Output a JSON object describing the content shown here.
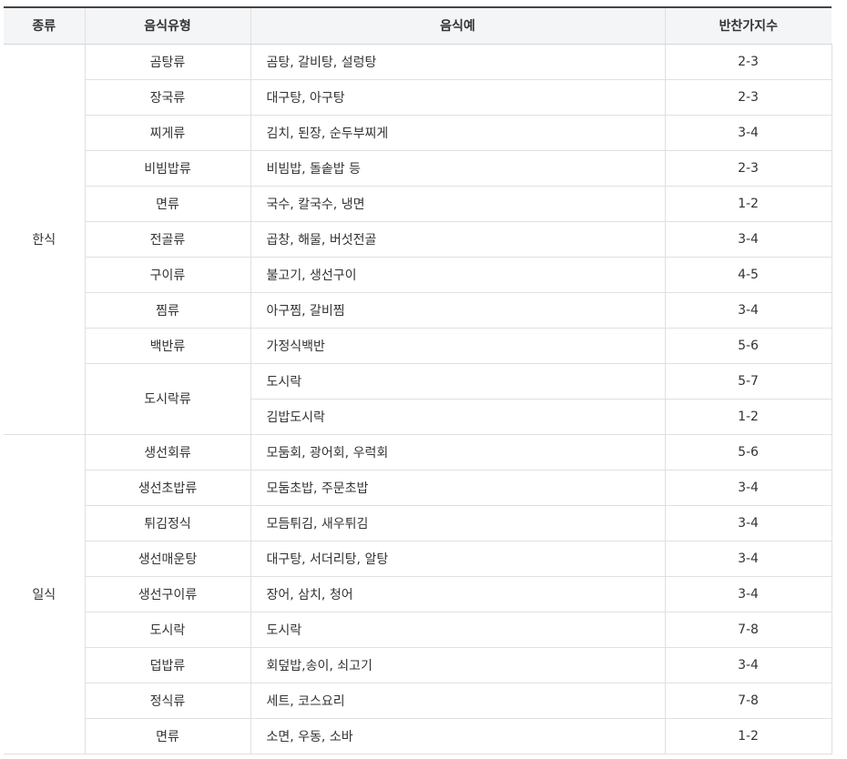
{
  "headers": [
    "종류",
    "음식유형",
    "음식예",
    "반찬가지수"
  ],
  "groups": [
    {
      "category": "한식",
      "types": [
        {
          "type": "곰탕류",
          "rows": [
            {
              "example": "곰탕, 갈비탕, 설렁탕",
              "count": "2-3"
            }
          ]
        },
        {
          "type": "장국류",
          "rows": [
            {
              "example": "대구탕, 아구탕",
              "count": "2-3"
            }
          ]
        },
        {
          "type": "찌게류",
          "rows": [
            {
              "example": "김치, 된장, 순두부찌게",
              "count": "3-4"
            }
          ]
        },
        {
          "type": "비빔밥류",
          "rows": [
            {
              "example": "비빔밥, 돌솥밥 등",
              "count": "2-3"
            }
          ]
        },
        {
          "type": "면류",
          "rows": [
            {
              "example": "국수, 칼국수, 냉면",
              "count": "1-2"
            }
          ]
        },
        {
          "type": "전골류",
          "rows": [
            {
              "example": "곱창, 해물, 버섯전골",
              "count": "3-4"
            }
          ]
        },
        {
          "type": "구이류",
          "rows": [
            {
              "example": "불고기, 생선구이",
              "count": "4-5"
            }
          ]
        },
        {
          "type": "찜류",
          "rows": [
            {
              "example": "아구찜, 갈비찜",
              "count": "3-4"
            }
          ]
        },
        {
          "type": "백반류",
          "rows": [
            {
              "example": "가정식백반",
              "count": "5-6"
            }
          ]
        },
        {
          "type": "도시락류",
          "rows": [
            {
              "example": "도시락",
              "count": "5-7"
            },
            {
              "example": "김밥도시락",
              "count": "1-2"
            }
          ]
        }
      ]
    },
    {
      "category": "일식",
      "types": [
        {
          "type": "생선회류",
          "rows": [
            {
              "example": "모둠회, 광어회, 우럭회",
              "count": "5-6"
            }
          ]
        },
        {
          "type": "생선초밥류",
          "rows": [
            {
              "example": "모둠초밥, 주문초밥",
              "count": "3-4"
            }
          ]
        },
        {
          "type": "튀김정식",
          "rows": [
            {
              "example": "모듬튀김, 새우튀김",
              "count": "3-4"
            }
          ]
        },
        {
          "type": "생선매운탕",
          "rows": [
            {
              "example": "대구탕, 서더리탕, 알탕",
              "count": "3-4"
            }
          ]
        },
        {
          "type": "생선구이류",
          "rows": [
            {
              "example": "장어, 삼치, 청어",
              "count": "3-4"
            }
          ]
        },
        {
          "type": "도시락",
          "rows": [
            {
              "example": "도시락",
              "count": "7-8"
            }
          ]
        },
        {
          "type": "덥밥류",
          "rows": [
            {
              "example": "회덮밥,송이, 쇠고기",
              "count": "3-4"
            }
          ]
        },
        {
          "type": "정식류",
          "rows": [
            {
              "example": "세트, 코스요리",
              "count": "7-8"
            }
          ]
        },
        {
          "type": "면류",
          "rows": [
            {
              "example": "소면, 우동, 소바",
              "count": "1-2"
            }
          ]
        }
      ]
    }
  ]
}
